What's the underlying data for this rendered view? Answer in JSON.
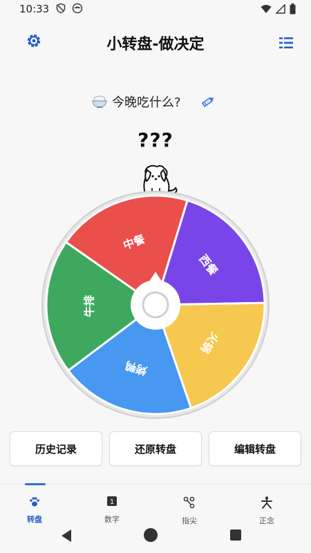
{
  "status_bar": {
    "time": "10:33"
  },
  "header": {
    "title": "小转盘-做决定"
  },
  "question": {
    "text": "今晚吃什么?"
  },
  "result": {
    "text": "???"
  },
  "wheel": {
    "segments": [
      {
        "label": "中餐",
        "color": "#ea4f4c"
      },
      {
        "label": "西餐",
        "color": "#7a45e8"
      },
      {
        "label": "火锅",
        "color": "#f7c84f"
      },
      {
        "label": "烤鸭",
        "color": "#4698f0"
      },
      {
        "label": "牛排",
        "color": "#3ea95e"
      }
    ]
  },
  "actions": {
    "history": "历史记录",
    "reset": "还原转盘",
    "edit": "编辑转盘"
  },
  "nav": {
    "items": [
      {
        "label": "转盘",
        "icon": "paw-icon",
        "active": true
      },
      {
        "label": "数字",
        "icon": "number-icon",
        "active": false
      },
      {
        "label": "指尖",
        "icon": "fingertip-icon",
        "active": false
      },
      {
        "label": "正念",
        "icon": "meditation-icon",
        "active": false
      }
    ]
  },
  "colors": {
    "accent": "#1f5fc8"
  }
}
